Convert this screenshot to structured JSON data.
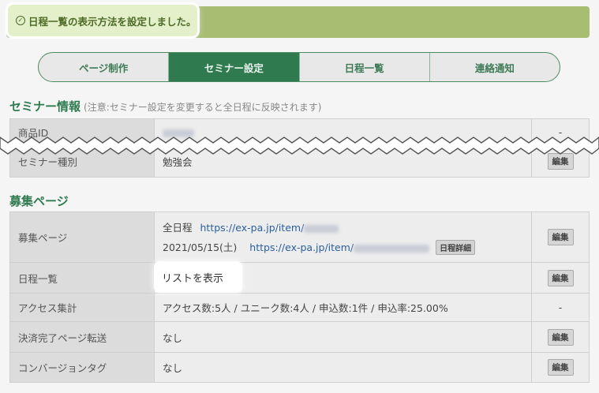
{
  "alert": {
    "message": "日程一覧の表示方法を設定しました。",
    "icon": "check-circle-icon"
  },
  "tabs": [
    {
      "label": "ページ制作",
      "active": false
    },
    {
      "label": "セミナー設定",
      "active": true
    },
    {
      "label": "日程一覧",
      "active": false
    },
    {
      "label": "連絡通知",
      "active": false
    }
  ],
  "seminar": {
    "title": "セミナー情報",
    "note": "(注意:セミナー設定を変更すると全日程に反映されます)",
    "rows": [
      {
        "label": "商品ID",
        "value": "",
        "action": "-"
      },
      {
        "label": "セミナー種別",
        "value": "勉強会",
        "action": "編集"
      }
    ]
  },
  "recruit": {
    "title": "募集ページ",
    "page_row": {
      "label": "募集ページ",
      "all_label": "全日程",
      "all_url": "https://ex-pa.jp/item/",
      "date": "2021/05/15(土)",
      "date_url": "https://ex-pa.jp/item/",
      "detail_button": "日程詳細",
      "action": "編集"
    },
    "rows": [
      {
        "label": "日程一覧",
        "value": "リストを表示",
        "action": "編集"
      },
      {
        "label": "アクセス集計",
        "value": "アクセス数:5人 / ユニーク数:4人 / 申込数:1件 / 申込率:25.00%",
        "action": "-"
      },
      {
        "label": "決済完了ページ転送",
        "value": "なし",
        "action": "編集"
      },
      {
        "label": "コンバージョンタグ",
        "value": "なし",
        "action": "編集"
      }
    ]
  },
  "colors": {
    "accent": "#2f7a4f",
    "alert_bg": "#a6bd72",
    "link": "#2a5fa0"
  }
}
